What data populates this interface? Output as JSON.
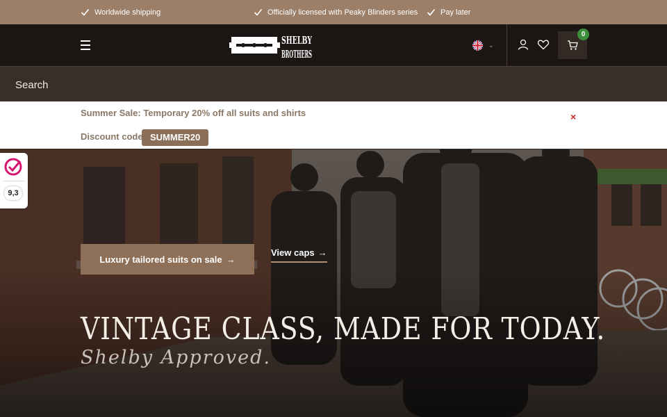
{
  "usp_bar": {
    "items": [
      {
        "label": "Worldwide shipping",
        "icon": "check-icon"
      },
      {
        "label": "Officially licensed with Peaky Blinders series",
        "icon": "check-icon"
      },
      {
        "label": "Pay later",
        "icon": "check-icon"
      }
    ]
  },
  "header": {
    "logo": {
      "line1": "SHELBY",
      "line2": "BROTHERS",
      "icon": "razor-blade-logo"
    },
    "menu_icon": "hamburger-icon",
    "language_icon": "uk-flag-icon",
    "account_icon": "user-icon",
    "wishlist_icon": "heart-icon",
    "cart": {
      "icon": "cart-icon",
      "count": "0"
    }
  },
  "search": {
    "placeholder": "Search"
  },
  "promo": {
    "title": "Summer Sale: Temporary 20% off all suits and shirts",
    "code_label": "Discount code",
    "code": "SUMMER20",
    "close_label": "×"
  },
  "hero": {
    "title": "VINTAGE CLASS, MADE FOR TODAY.",
    "script": "Shelby Approved.",
    "cta_primary": "Luxury tailored suits on sale",
    "cta_secondary": "View caps"
  },
  "rating_widget": {
    "score": "9,3",
    "icon": "kiyoh-logo"
  },
  "colors": {
    "usp_bar": "#9b7f69",
    "header": "#1b1613",
    "search_bar": "#3a2f28",
    "accent": "#8a6e58",
    "promo_text": "#8b7764",
    "cart_badge": "#3c8e3a",
    "close": "#c62828"
  }
}
